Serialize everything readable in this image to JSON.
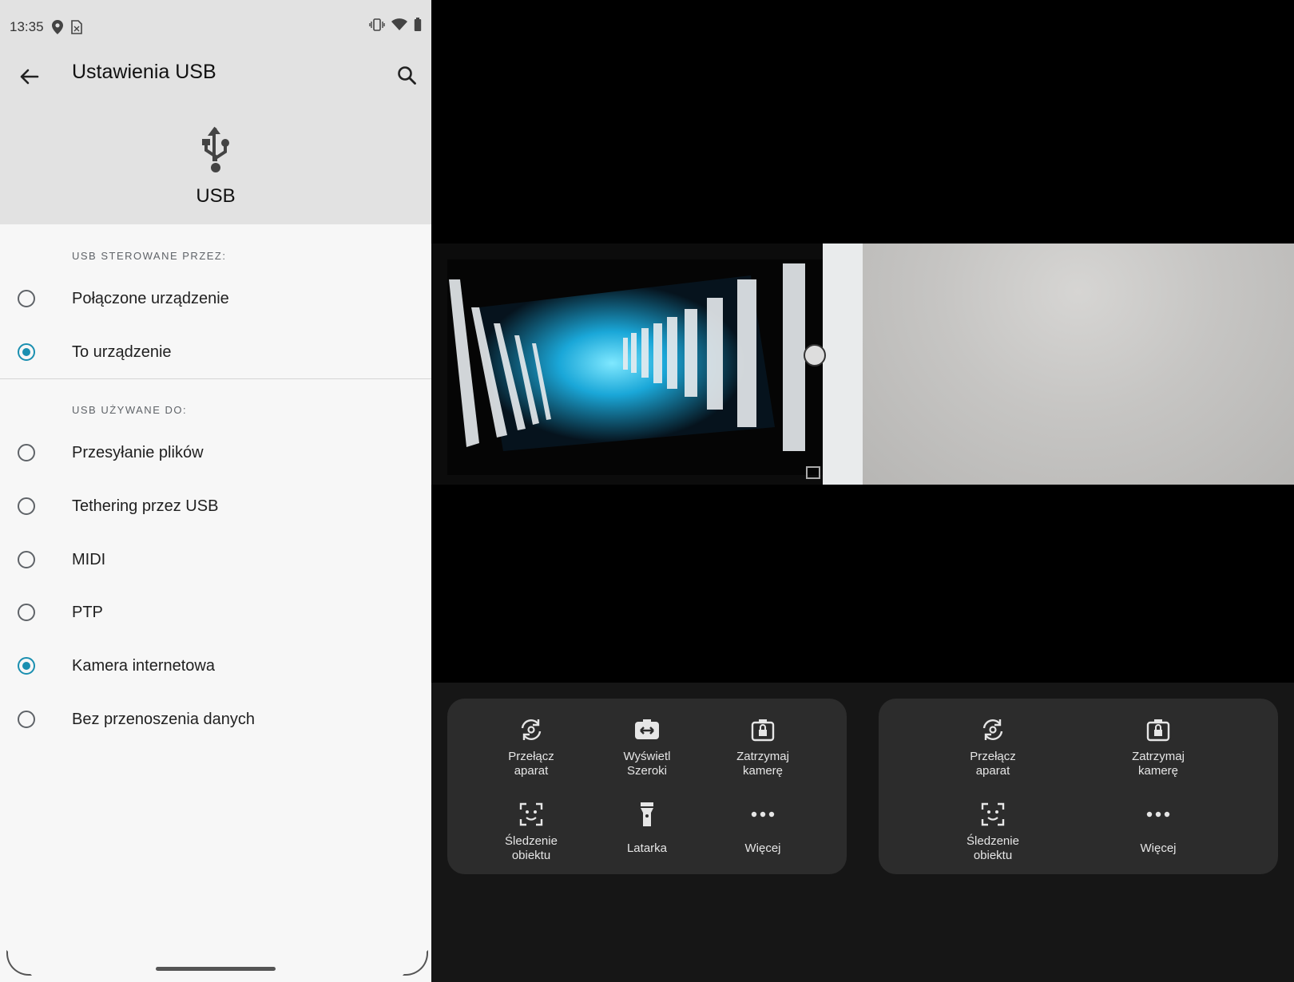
{
  "status_bar": {
    "time": "13:35"
  },
  "app_bar": {
    "title": "Ustawienia USB"
  },
  "header": {
    "usb_label": "USB"
  },
  "controlled_by": {
    "section_title": "USB STEROWANE PRZEZ:",
    "options": [
      {
        "label": "Połączone urządzenie",
        "checked": false
      },
      {
        "label": "To urządzenie",
        "checked": true
      }
    ]
  },
  "used_for": {
    "section_title": "USB UŻYWANE DO:",
    "options": [
      {
        "label": "Przesyłanie plików",
        "checked": false
      },
      {
        "label": "Tethering przez USB",
        "checked": false
      },
      {
        "label": "MIDI",
        "checked": false
      },
      {
        "label": "PTP",
        "checked": false
      },
      {
        "label": "Kamera internetowa",
        "checked": true
      },
      {
        "label": "Bez przenoszenia danych",
        "checked": false
      }
    ]
  },
  "panel_left": {
    "switch_camera": "Przełącz\naparat",
    "wide_view": "Wyświetl\nSzeroki",
    "pause_camera": "Zatrzymaj\nkamerę",
    "tracking": "Śledzenie\nobiektu",
    "flashlight": "Latarka",
    "more": "Więcej"
  },
  "panel_right": {
    "switch_camera": "Przełącz\naparat",
    "pause_camera": "Zatrzymaj\nkamerę",
    "tracking": "Śledzenie\nobiektu",
    "more": "Więcej"
  },
  "colors": {
    "accent": "#1a8fb0",
    "panel_bg": "#2c2c2c",
    "header_bg": "#e2e2e2"
  }
}
